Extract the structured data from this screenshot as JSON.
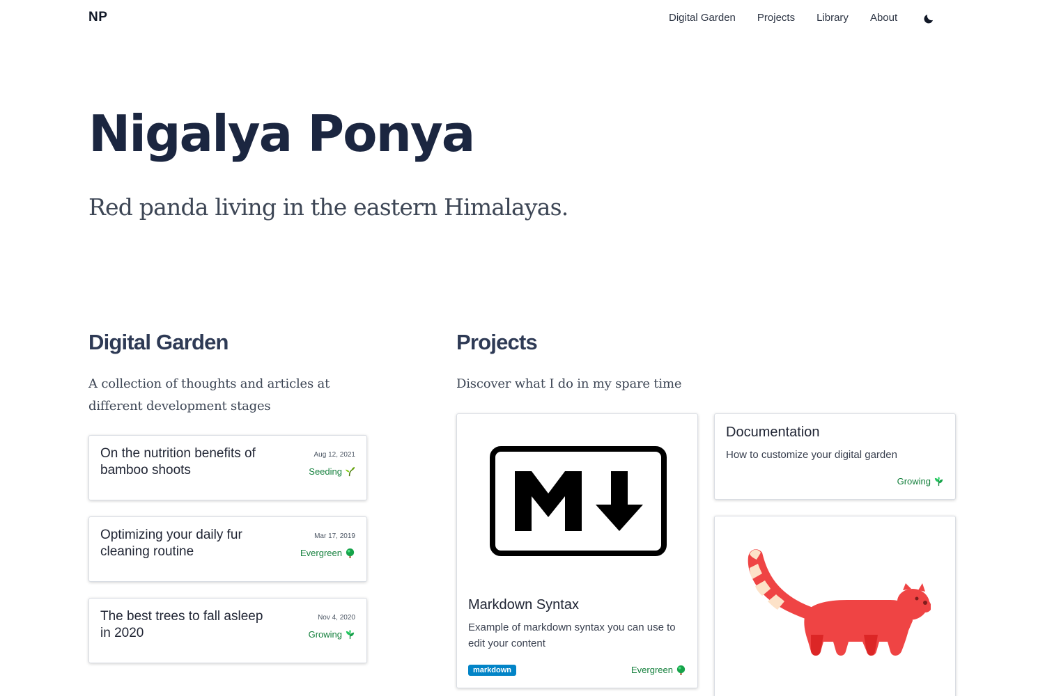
{
  "header": {
    "logo": "NP",
    "nav": [
      {
        "label": "Digital Garden"
      },
      {
        "label": "Projects"
      },
      {
        "label": "Library"
      },
      {
        "label": "About"
      }
    ],
    "theme_toggle_icon": "moon-icon"
  },
  "hero": {
    "title": "Nigalya Ponya",
    "subtitle": "Red panda living in the eastern Himalayas."
  },
  "garden": {
    "title": "Digital Garden",
    "description": "A collection of thoughts and articles at different development stages",
    "items": [
      {
        "title": "On the nutrition benefits of bamboo shoots",
        "date": "Aug 12, 2021",
        "stage": "Seeding",
        "icon": "seedling-icon"
      },
      {
        "title": "Optimizing your daily fur cleaning routine",
        "date": "Mar 17, 2019",
        "stage": "Evergreen",
        "icon": "tree-icon"
      },
      {
        "title": "The best trees to fall asleep in 2020",
        "date": "Nov 4, 2020",
        "stage": "Growing",
        "icon": "herb-icon"
      }
    ]
  },
  "projects": {
    "title": "Projects",
    "description": "Discover what I do in my spare time",
    "items": [
      {
        "title": "Markdown Syntax",
        "description": "Example of markdown syntax you can use to edit your content",
        "tag": "markdown",
        "stage": "Evergreen",
        "image": "markdown-logo-icon",
        "stage_icon": "tree-icon"
      },
      {
        "title": "Documentation",
        "description": "How to customize your digital garden",
        "stage": "Growing",
        "stage_icon": "herb-icon"
      },
      {
        "image": "red-panda-icon"
      }
    ]
  },
  "colors": {
    "stage_green": "#15803d",
    "tag_blue": "#0284c7",
    "panda_red": "#ef4444",
    "panda_stripe": "#fde2c8"
  }
}
